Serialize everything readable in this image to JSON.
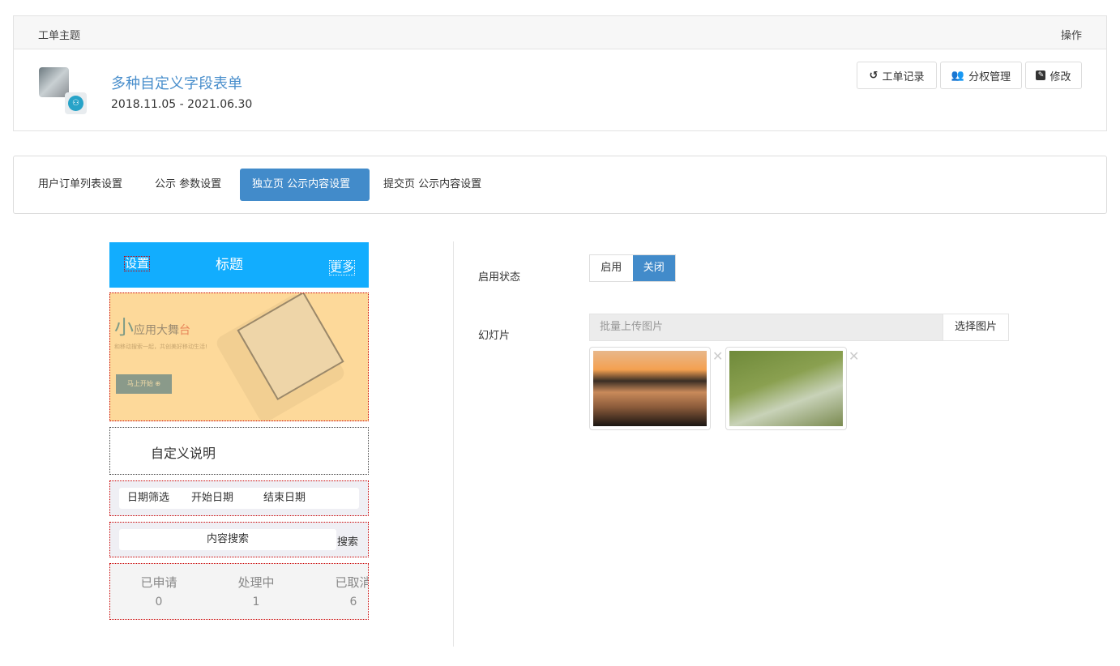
{
  "header": {
    "col_subject": "工单主题",
    "col_action": "操作"
  },
  "ticket": {
    "title": "多种自定义字段表单",
    "date_range": "2018.11.05 - 2021.06.30",
    "buttons": [
      {
        "label": "工单记录",
        "icon": "history-icon"
      },
      {
        "label": "分权管理",
        "icon": "users-icon"
      },
      {
        "label": "修改",
        "icon": "edit-icon"
      }
    ]
  },
  "tabs": [
    {
      "label": "用户订单列表设置"
    },
    {
      "label": "公示 参数设置"
    },
    {
      "label": "独立页 公示内容设置",
      "active": true
    },
    {
      "label": "提交页 公示内容设置"
    }
  ],
  "preview": {
    "nav_left": "设置",
    "nav_title": "标题",
    "nav_right": "更多",
    "banner": {
      "headline_small": "小",
      "headline_rest": "应用大舞",
      "headline_accent": "台",
      "subtitle": "和移动搜索一起，共创美好移动生活!",
      "cta": "马上开始"
    },
    "custom_desc": "自定义说明",
    "date_filter": {
      "label": "日期筛选",
      "start": "开始日期",
      "end": "结束日期"
    },
    "search": {
      "placeholder": "内容搜索",
      "button": "搜索"
    },
    "stats": [
      {
        "label": "已申请",
        "value": "0"
      },
      {
        "label": "处理中",
        "value": "1"
      },
      {
        "label": "已取消",
        "value": "6"
      }
    ]
  },
  "settings": {
    "status_label": "启用状态",
    "status_on": "启用",
    "status_off": "关闭",
    "status_selected": "关闭",
    "slides_label": "幻灯片",
    "upload_placeholder": "批量上传图片",
    "choose_button": "选择图片"
  },
  "colors": {
    "accent": "#428bca",
    "phone_header": "#12adfe",
    "banner_bg": "#fdd99a",
    "link": "#4a8fcc"
  }
}
